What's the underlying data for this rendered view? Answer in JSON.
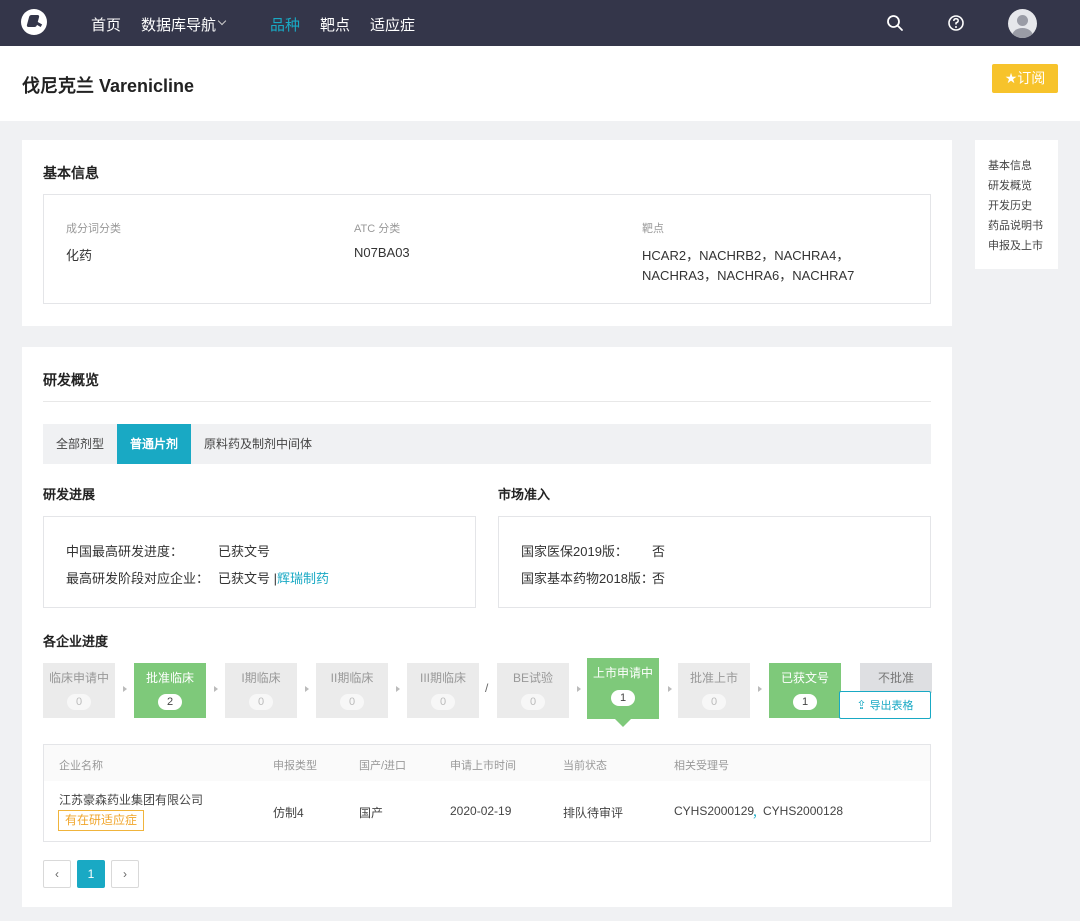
{
  "nav": {
    "items": [
      "首页",
      "数据库导航",
      "品种",
      "靶点",
      "适应症"
    ],
    "active_index": 2,
    "accent_color": "#19a9c4",
    "icons": [
      "logo-icon",
      "search-icon",
      "help-icon",
      "user-avatar-icon"
    ]
  },
  "page": {
    "title": "伐尼克兰 Varenicline",
    "subscribe_label": "订阅",
    "subscribe_color": "#f7c32b"
  },
  "basic_info": {
    "title": "基本信息",
    "fields": [
      {
        "label": "成分词分类",
        "value": "化药"
      },
      {
        "label": "ATC 分类",
        "value": "N07BA03"
      },
      {
        "label": "靶点",
        "value_line1": "HCAR2，NACHRB2，NACHRA4，",
        "value_line2": "NACHRA3，NACHRA6，NACHRA7"
      }
    ]
  },
  "side_nav": [
    "基本信息",
    "研发概览",
    "开发历史",
    "药品说明书",
    "申报及上市"
  ],
  "overview": {
    "title": "研发概览",
    "tabs": [
      "全部剂型",
      "普通片剂",
      "原料药及制剂中间体"
    ],
    "active_tab": 1,
    "progress": {
      "title": "研发进展",
      "row1_label": "中国最高研发进度：",
      "row1_value": "已获文号",
      "row2_label": "最高研发阶段对应企业：",
      "row2_value": "已获文号 |",
      "row2_link": "辉瑞制药"
    },
    "market": {
      "title": "市场准入",
      "row1_label": "国家医保2019版：",
      "row1_value": "否",
      "row2_label": "国家基本药物2018版：",
      "row2_value": "否"
    },
    "company_progress_title": "各企业进度",
    "stages": [
      {
        "name": "临床申请中",
        "count": "0",
        "highlight": false
      },
      {
        "name": "批准临床",
        "count": "2",
        "highlight": true
      },
      {
        "name": "I期临床",
        "count": "0",
        "highlight": false
      },
      {
        "name": "II期临床",
        "count": "0",
        "highlight": false
      },
      {
        "name": "III期临床",
        "count": "0",
        "highlight": false
      },
      {
        "name": "BE试验",
        "count": "0",
        "highlight": false
      },
      {
        "name": "上市申请中",
        "count": "1",
        "highlight": true
      },
      {
        "name": "批准上市",
        "count": "0",
        "highlight": false
      },
      {
        "name": "已获文号",
        "count": "1",
        "highlight": true
      },
      {
        "name": "不批准",
        "count": "",
        "highlight": false
      }
    ],
    "stage_separator": "/",
    "export_label": "导出表格",
    "table": {
      "headers": [
        "企业名称",
        "申报类型",
        "国产/进口",
        "申请上市时间",
        "当前状态",
        "相关受理号"
      ],
      "rows": [
        {
          "company": "江苏豪森药业集团有限公司",
          "tag": "有在研适应症",
          "type": "仿制4",
          "origin": "国产",
          "date": "2020-02-19",
          "status": "排队待审评",
          "ref1": "CYHS2000129",
          "ref_sep": "，",
          "ref2": "CYHS2000128"
        }
      ]
    },
    "pagination": {
      "prev": "‹",
      "current": "1",
      "next": "›"
    }
  }
}
